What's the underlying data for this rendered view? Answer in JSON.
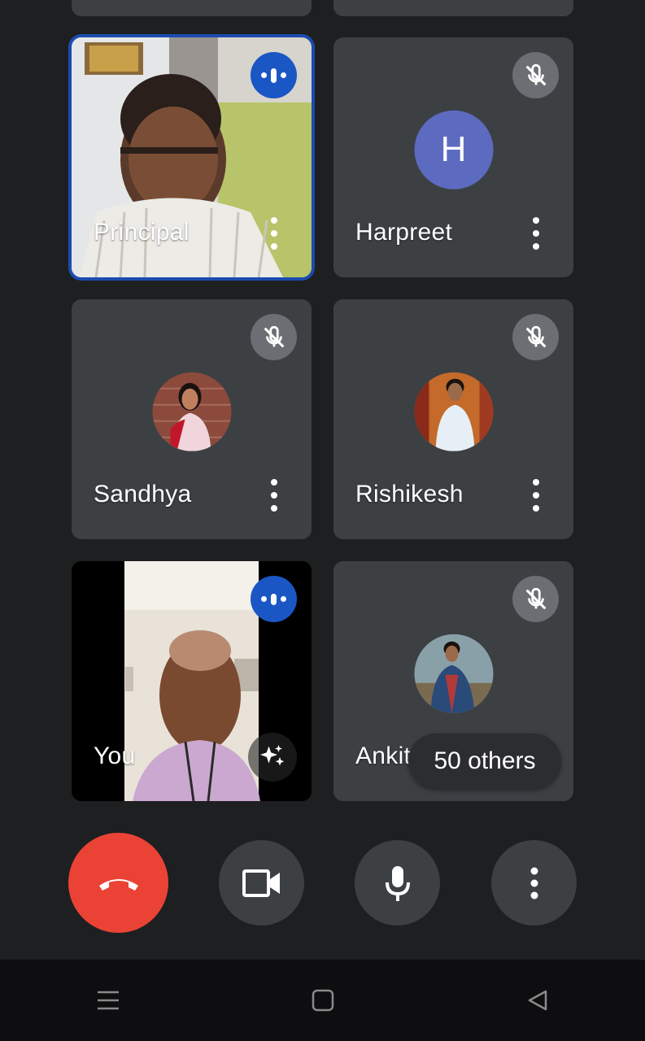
{
  "participants": {
    "principal": {
      "name": "Principal",
      "state": "speaking"
    },
    "harpreet": {
      "name": "Harpreet",
      "initial": "H",
      "state": "muted"
    },
    "sandhya": {
      "name": "Sandhya",
      "state": "muted"
    },
    "rishikesh": {
      "name": "Rishikesh",
      "state": "muted"
    },
    "you": {
      "name": "You",
      "state": "speaking"
    },
    "ankit": {
      "name": "Ankit",
      "state": "muted"
    }
  },
  "others_badge": "50 others",
  "controls": {
    "end_call_color": "#ea4335",
    "icons": [
      "end-call-icon",
      "camera-icon",
      "microphone-icon",
      "more-options-icon"
    ]
  },
  "colors": {
    "background": "#1e1f21",
    "tile": "#3c4043",
    "active_speaker_border": "#1c4bb0",
    "letter_avatar": "#5c6bc0"
  }
}
